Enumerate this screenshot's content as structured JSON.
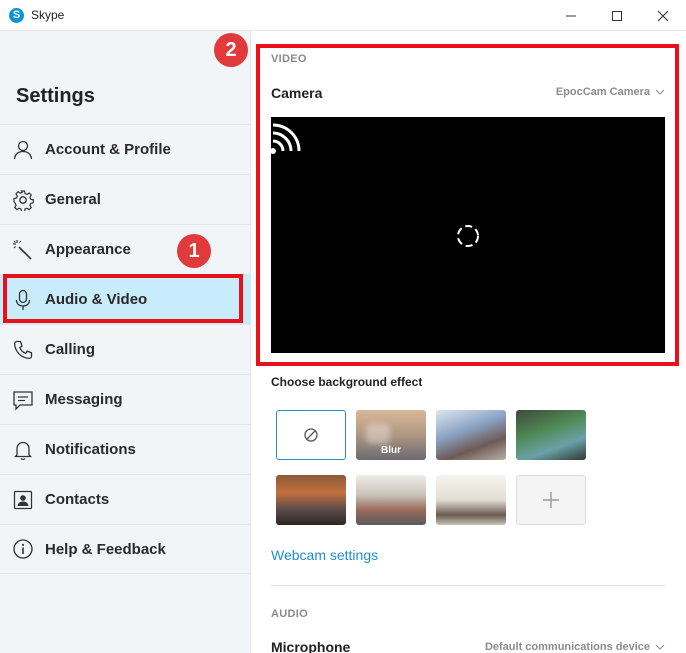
{
  "window": {
    "title": "Skype",
    "logo_letter": "S"
  },
  "sidebar": {
    "title": "Settings",
    "items": [
      {
        "label": "Account & Profile",
        "icon": "person-icon"
      },
      {
        "label": "General",
        "icon": "gear-icon"
      },
      {
        "label": "Appearance",
        "icon": "magic-wand-icon"
      },
      {
        "label": "Audio & Video",
        "icon": "microphone-icon",
        "active": true
      },
      {
        "label": "Calling",
        "icon": "phone-icon"
      },
      {
        "label": "Messaging",
        "icon": "message-icon"
      },
      {
        "label": "Notifications",
        "icon": "bell-icon"
      },
      {
        "label": "Contacts",
        "icon": "contacts-icon"
      },
      {
        "label": "Help & Feedback",
        "icon": "info-icon"
      }
    ]
  },
  "annotations": {
    "badge_1": "1",
    "badge_2": "2",
    "color": "#e8101a"
  },
  "video": {
    "section_label": "VIDEO",
    "camera_label": "Camera",
    "camera_value": "EpocCam Camera",
    "background_effect_label": "Choose background effect",
    "effects": [
      {
        "type": "none",
        "icon": "no-effect-icon"
      },
      {
        "type": "blur",
        "label": "Blur"
      },
      {
        "type": "image"
      },
      {
        "type": "image"
      },
      {
        "type": "image"
      },
      {
        "type": "image"
      },
      {
        "type": "image"
      },
      {
        "type": "add",
        "icon": "plus-icon"
      }
    ],
    "webcam_settings_link": "Webcam settings"
  },
  "audio": {
    "section_label": "AUDIO",
    "microphone_label": "Microphone",
    "microphone_value": "Default communications device"
  },
  "colors": {
    "accent": "#1d8fd1",
    "active_nav": "#c9ecfb",
    "sidebar_bg": "#f2f5f8"
  }
}
